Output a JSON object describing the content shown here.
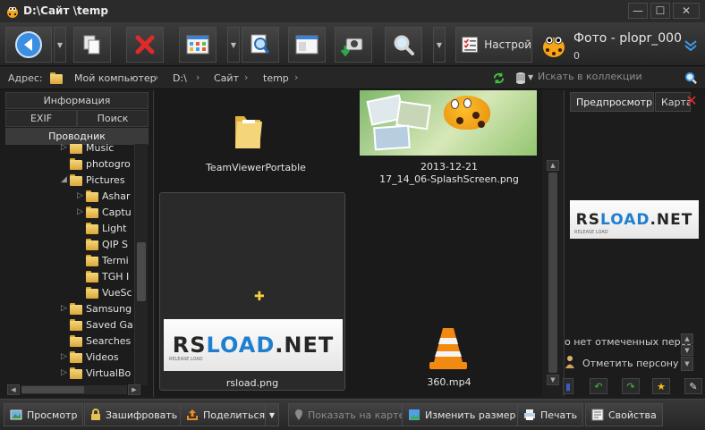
{
  "window": {
    "title": "D:\\Сайт \\temp",
    "minimize": "—",
    "maximize": "☐",
    "close": "✕"
  },
  "toolbar": {
    "settings_label": "Настрой",
    "brand_title": "Фото - plopr_000",
    "brand_count": "0",
    "expand_icon": "chevron-double-down-icon"
  },
  "address": {
    "label": "Адрес:",
    "crumbs": [
      "Мой компьютер",
      "D:\\",
      "Сайт",
      "temp"
    ],
    "search_placeholder": "Искать в коллекции"
  },
  "left_tabs": {
    "info": "Информация",
    "exif": "EXIF",
    "search": "Поиск",
    "explorer": "Проводник"
  },
  "tree": [
    {
      "label": "Music",
      "arrow": "▷"
    },
    {
      "label": "photogro",
      "arrow": ""
    },
    {
      "label": "Pictures",
      "arrow": "◢"
    },
    {
      "label": "Ashar",
      "arrow": "▷"
    },
    {
      "label": "Captu",
      "arrow": "▷"
    },
    {
      "label": "Light",
      "arrow": ""
    },
    {
      "label": "QIP S",
      "arrow": ""
    },
    {
      "label": "Termi",
      "arrow": ""
    },
    {
      "label": "TGH I",
      "arrow": ""
    },
    {
      "label": "VueSc",
      "arrow": ""
    },
    {
      "label": "Samsung",
      "arrow": "▷"
    },
    {
      "label": "Saved Ga",
      "arrow": ""
    },
    {
      "label": "Searches",
      "arrow": ""
    },
    {
      "label": "Videos",
      "arrow": "▷"
    },
    {
      "label": "VirtualBo",
      "arrow": "▷"
    }
  ],
  "files": {
    "folder_label": "TeamViewerPortable",
    "splash_label_line1": "2013-12-21",
    "splash_label_line2": "17_14_06-SplashScreen.png",
    "rsload_label": "rsload.png",
    "video_label": "360.mp4",
    "rsload_logo_rs": "RS",
    "rsload_logo_load": "LOAD",
    "rsload_logo_net": ".NET",
    "rsload_sub": "RELEASE LOAD",
    "add_mark": "✚"
  },
  "right_panel": {
    "tab_preview": "Предпросмотр",
    "tab_map": "Карта",
    "no_persons": "о нет отмеченных персо",
    "mark_person": "Отметить персону"
  },
  "bottom": {
    "preview": "Просмотр",
    "encrypt": "Зашифровать",
    "share": "Поделиться",
    "show_on_map": "Показать на карте",
    "resize": "Изменить размер",
    "print": "Печать",
    "properties": "Свойства"
  },
  "colors": {
    "background": "#1e1e1e",
    "accent_blue": "#1e7fd0",
    "folder_yellow": "#e8c052",
    "close_red": "#e03030"
  }
}
